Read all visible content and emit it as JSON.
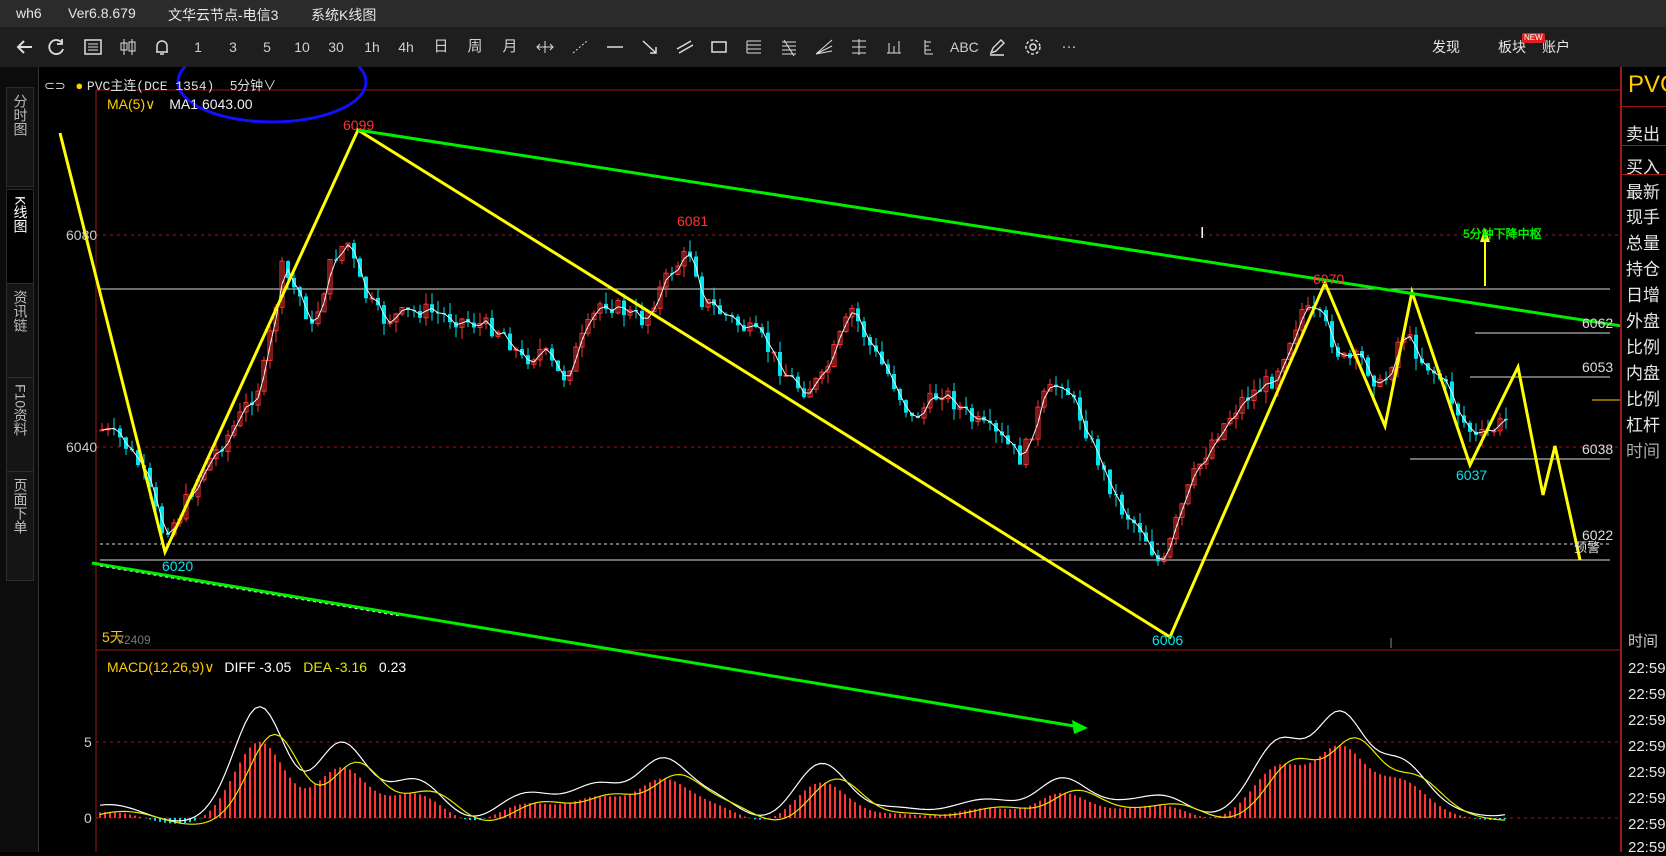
{
  "titlebar": {
    "app": "wh6",
    "version": "Ver6.8.679",
    "server": "文华云节点-电信3",
    "page": "系统K线图"
  },
  "toolbar": {
    "periods": [
      "1",
      "3",
      "5",
      "10",
      "30",
      "1h",
      "4h",
      "日",
      "周",
      "月"
    ],
    "abc": "ABC",
    "more": "···",
    "discover": "发现",
    "new_badge": "NEW",
    "sector": "板块",
    "account": "账户"
  },
  "sidebar": {
    "tabs": [
      "分时图",
      "K线图",
      "资讯链",
      "F10资料",
      "页面下单"
    ]
  },
  "main_chart": {
    "instrument": "PVC主连(DCE 1354)",
    "period": "5分钟",
    "ma_label": "MA(5)",
    "ma_value": "MA1 6043.00",
    "price_ticks": [
      "6080",
      "6040"
    ],
    "left_bottom_label": "5天",
    "contract_label": "V2409",
    "annotation": "5分钟下降中枢",
    "cursor_glyph": "I",
    "points": {
      "p1": "6099",
      "p2": "6081",
      "p3": "6070",
      "p4": "6020",
      "p5": "6006",
      "p6": "6037"
    },
    "right_levels": [
      "6062",
      "6053",
      "6038",
      "6022"
    ],
    "alert_label": "预警"
  },
  "macd": {
    "label": "MACD(12,26,9)",
    "diff": "DIFF -3.05",
    "dea": "DEA -3.16",
    "macd": "0.23",
    "ticks": [
      "5",
      "0"
    ]
  },
  "right_panel": {
    "title": "PVC",
    "items": [
      "卖出",
      "买入",
      "最新",
      "现手",
      "总量",
      "持仓",
      "日增",
      "外盘",
      "比例",
      "内盘",
      "比例",
      "杠杆",
      "时间"
    ],
    "time_label": "时间",
    "times": [
      "22:59",
      "22:59",
      "22:59",
      "22:59",
      "22:59",
      "22:59",
      "22:59",
      "22:59"
    ]
  },
  "colors": {
    "up": "#ff3333",
    "down": "#00e5ee",
    "trend_yellow": "#ffff00",
    "trend_green": "#00ee00",
    "circle": "#1010ff"
  }
}
